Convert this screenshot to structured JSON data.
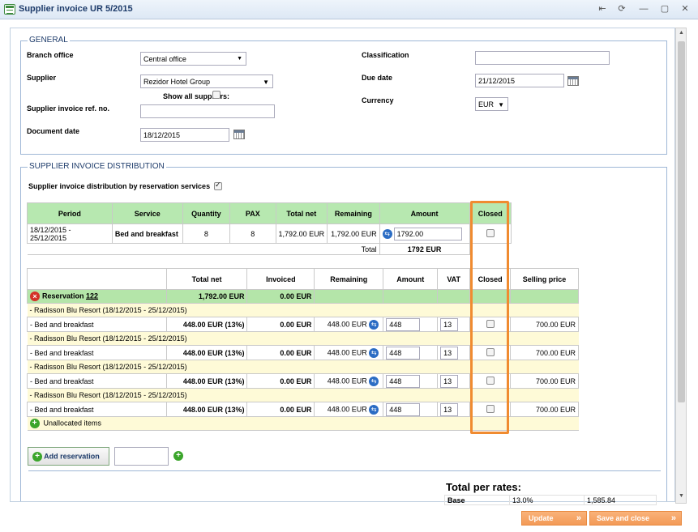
{
  "window": {
    "title": "Supplier invoice UR 5/2015",
    "controls": [
      "⇤",
      "⟳",
      "—",
      "▢",
      "✕"
    ]
  },
  "general": {
    "legend": "GENERAL",
    "branch_office_label": "Branch office",
    "branch_office_value": "Central office",
    "supplier_label": "Supplier",
    "supplier_value": "Rezidor Hotel Group",
    "show_all_suppliers_label": "Show all suppliers:",
    "ref_no_label": "Supplier invoice ref. no.",
    "ref_no_value": "",
    "document_date_label": "Document date",
    "document_date_value": "18/12/2015",
    "classification_label": "Classification",
    "classification_value": "",
    "due_date_label": "Due date",
    "due_date_value": "21/12/2015",
    "currency_label": "Currency",
    "currency_value": "EUR"
  },
  "distribution": {
    "legend": "SUPPLIER INVOICE DISTRIBUTION",
    "by_services_label": "Supplier invoice distribution by reservation services",
    "by_services_checked": true,
    "top_table": {
      "headers": [
        "Period",
        "Service",
        "Quantity",
        "PAX",
        "Total net",
        "Remaining",
        "Amount",
        "Closed"
      ],
      "row": {
        "period": "18/12/2015 - 25/12/2015",
        "service": "Bed and breakfast",
        "quantity": "8",
        "pax": "8",
        "total_net": "1,792.00 EUR",
        "remaining": "1,792.00 EUR",
        "amount": "1792.00"
      },
      "total_label": "Total",
      "total_value": "1792 EUR"
    },
    "bottom_table": {
      "headers": [
        "",
        "Total net",
        "Invoiced",
        "Remaining",
        "Amount",
        "VAT",
        "Closed",
        "Selling price"
      ],
      "reservation": {
        "label": "Reservation",
        "number": "122",
        "total_net": "1,792.00 EUR",
        "invoiced": "0.00 EUR"
      },
      "groups": [
        {
          "group": "- Radisson Blu Resort (18/12/2015 - 25/12/2015)",
          "item": "- Bed and breakfast",
          "total_net": "448.00 EUR (13%)",
          "invoiced": "0.00 EUR",
          "remaining": "448.00 EUR",
          "amount": "448",
          "vat": "13",
          "selling": "700.00 EUR"
        },
        {
          "group": "- Radisson Blu Resort (18/12/2015 - 25/12/2015)",
          "item": "- Bed and breakfast",
          "total_net": "448.00 EUR (13%)",
          "invoiced": "0.00 EUR",
          "remaining": "448.00 EUR",
          "amount": "448",
          "vat": "13",
          "selling": "700.00 EUR"
        },
        {
          "group": "- Radisson Blu Resort (18/12/2015 - 25/12/2015)",
          "item": "- Bed and breakfast",
          "total_net": "448.00 EUR (13%)",
          "invoiced": "0.00 EUR",
          "remaining": "448.00 EUR",
          "amount": "448",
          "vat": "13",
          "selling": "700.00 EUR"
        },
        {
          "group": "- Radisson Blu Resort (18/12/2015 - 25/12/2015)",
          "item": "- Bed and breakfast",
          "total_net": "448.00 EUR (13%)",
          "invoiced": "0.00 EUR",
          "remaining": "448.00 EUR",
          "amount": "448",
          "vat": "13",
          "selling": "700.00 EUR"
        }
      ],
      "unallocated_label": "Unallocated items"
    },
    "add_reservation_label": "Add reservation"
  },
  "rates": {
    "title": "Total per rates:",
    "rows": [
      {
        "name": "Base",
        "rate": "13.0%",
        "value": "1,585.84"
      }
    ]
  },
  "footer": {
    "update_label": "Update",
    "save_close_label": "Save and close"
  },
  "colors": {
    "highlight": "#f08b30",
    "header_green": "#b7e8b0",
    "footer_orange": "#f39a56"
  }
}
